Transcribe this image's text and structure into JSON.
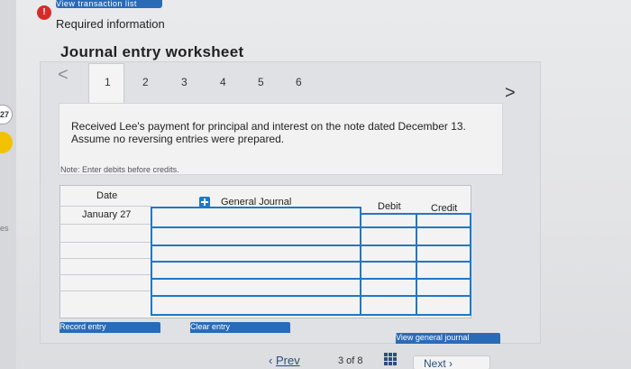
{
  "top_link": "View transaction list",
  "alert_icon": "!",
  "required_info": "Required information",
  "worksheet_title": "Journal entry worksheet",
  "nav": {
    "prev_arrow": "<",
    "next_arrow": ">",
    "tabs": [
      "1",
      "2",
      "3",
      "4",
      "5",
      "6"
    ],
    "active_tab": "1"
  },
  "description": "Received Lee's payment for principal and interest on the note dated December 13. Assume no reversing entries were prepared.",
  "note": "Note: Enter debits before credits.",
  "table": {
    "headers": {
      "date": "Date",
      "journal": "General Journal",
      "debit": "Debit",
      "credit": "Credit"
    },
    "rows": [
      {
        "date": "January 27",
        "account": "",
        "debit": "",
        "credit": ""
      },
      {
        "date": "",
        "account": "",
        "debit": "",
        "credit": ""
      },
      {
        "date": "",
        "account": "",
        "debit": "",
        "credit": ""
      },
      {
        "date": "",
        "account": "",
        "debit": "",
        "credit": ""
      },
      {
        "date": "",
        "account": "",
        "debit": "",
        "credit": ""
      },
      {
        "date": "",
        "account": "",
        "debit": "",
        "credit": ""
      }
    ]
  },
  "buttons": {
    "record": "Record entry",
    "clear": "Clear entry",
    "view": "View general journal"
  },
  "pager": {
    "prev": "Prev",
    "position": "3 of 8",
    "next": "Next"
  },
  "left_margin": {
    "badge": "27",
    "text": "es"
  },
  "colors": {
    "accent": "#2a6bb8",
    "grid_line": "#1f78c8",
    "alert": "#d72b2b"
  }
}
